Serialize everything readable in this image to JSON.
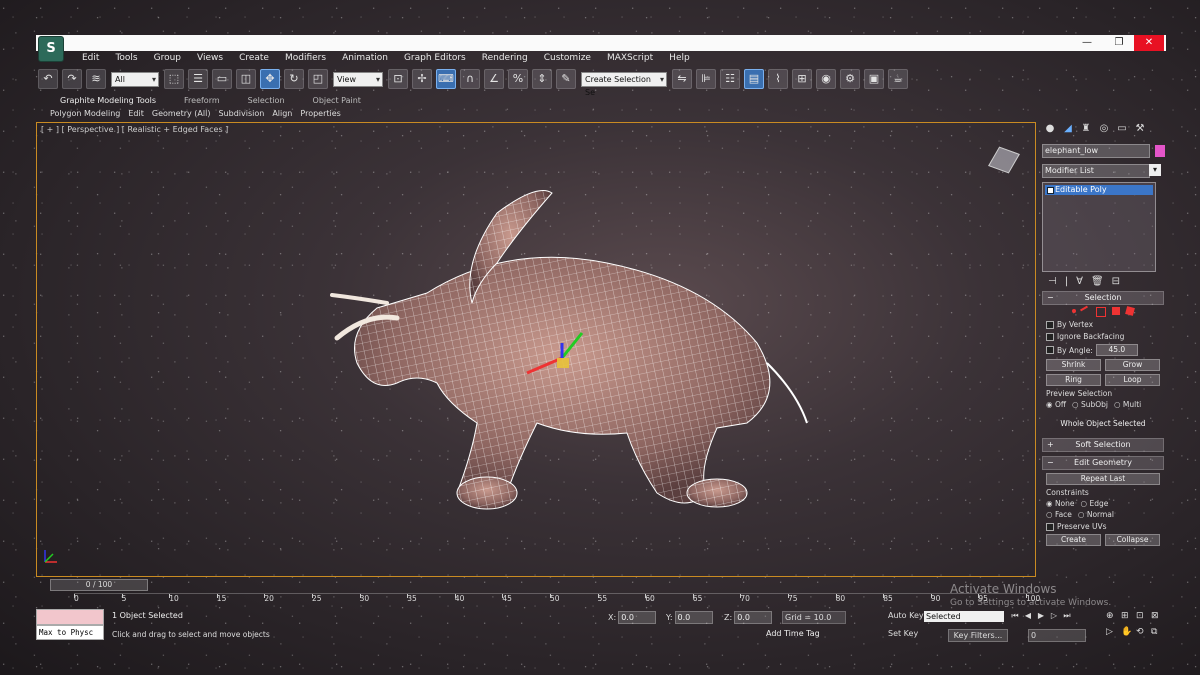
{
  "window": {
    "logo_label": "S",
    "controls": {
      "minimize": "—",
      "restore": "❐",
      "close": "✕"
    }
  },
  "menu": [
    "Edit",
    "Tools",
    "Group",
    "Views",
    "Create",
    "Modifiers",
    "Animation",
    "Graph Editors",
    "Rendering",
    "Customize",
    "MAXScript",
    "Help"
  ],
  "toolbar": {
    "selection_filter": "All",
    "reference_coord": "View",
    "named_selection": "Create Selection Se"
  },
  "ribbon": {
    "tabs": [
      "Graphite Modeling Tools",
      "Freeform",
      "Selection",
      "Object Paint"
    ],
    "subtabs": [
      "Polygon Modeling",
      "Edit",
      "Geometry (All)",
      "Subdivision",
      "Align",
      "Properties"
    ]
  },
  "viewport": {
    "label": "[ + ] [ Perspective ] [ Realistic + Edged Faces ]"
  },
  "command_panel": {
    "object_name": "elephant_low",
    "modifier_list": "Modifier List",
    "stack": [
      "Editable Poly"
    ],
    "selection": {
      "title": "Selection",
      "by_vertex": "By Vertex",
      "ignore_backfacing": "Ignore Backfacing",
      "by_angle": "By Angle:",
      "angle_value": "45.0",
      "shrink": "Shrink",
      "grow": "Grow",
      "ring": "Ring",
      "loop": "Loop",
      "preview_label": "Preview Selection",
      "preview_options": [
        "Off",
        "SubObj",
        "Multi"
      ],
      "whole_object": "Whole Object Selected"
    },
    "soft_selection": "Soft Selection",
    "edit_geometry": "Edit Geometry",
    "repeat_last": "Repeat Last",
    "constraints_label": "Constraints",
    "constraints": [
      "None",
      "Edge",
      "Face",
      "Normal"
    ],
    "preserve_uvs": "Preserve UVs",
    "create": "Create",
    "collapse": "Collapse"
  },
  "timeline": {
    "slider_label": "0 / 100",
    "ticks": [
      "0",
      "5",
      "10",
      "15",
      "20",
      "25",
      "30",
      "35",
      "40",
      "45",
      "50",
      "55",
      "60",
      "65",
      "70",
      "75",
      "80",
      "85",
      "90",
      "95",
      "100"
    ]
  },
  "status": {
    "maxscript_text": "Max to Physc",
    "selected": "1 Object Selected",
    "prompt": "Click and drag to select and move objects",
    "x_label": "X:",
    "x_value": "0.0",
    "y_label": "Y:",
    "y_value": "0.0",
    "z_label": "Z:",
    "z_value": "0.0",
    "grid": "Grid = 10.0",
    "add_time_tag": "Add Time Tag",
    "auto_key": "Auto Key",
    "set_key": "Set Key",
    "key_selection": "Selected",
    "key_filters": "Key Filters...",
    "frame": "0"
  },
  "watermark": {
    "line1": "Activate Windows",
    "line2": "Go to Settings to activate Windows."
  },
  "colors": {
    "accent": "#3b76c8",
    "viewport_border": "#c98b22",
    "object_color": "#e455c9"
  }
}
